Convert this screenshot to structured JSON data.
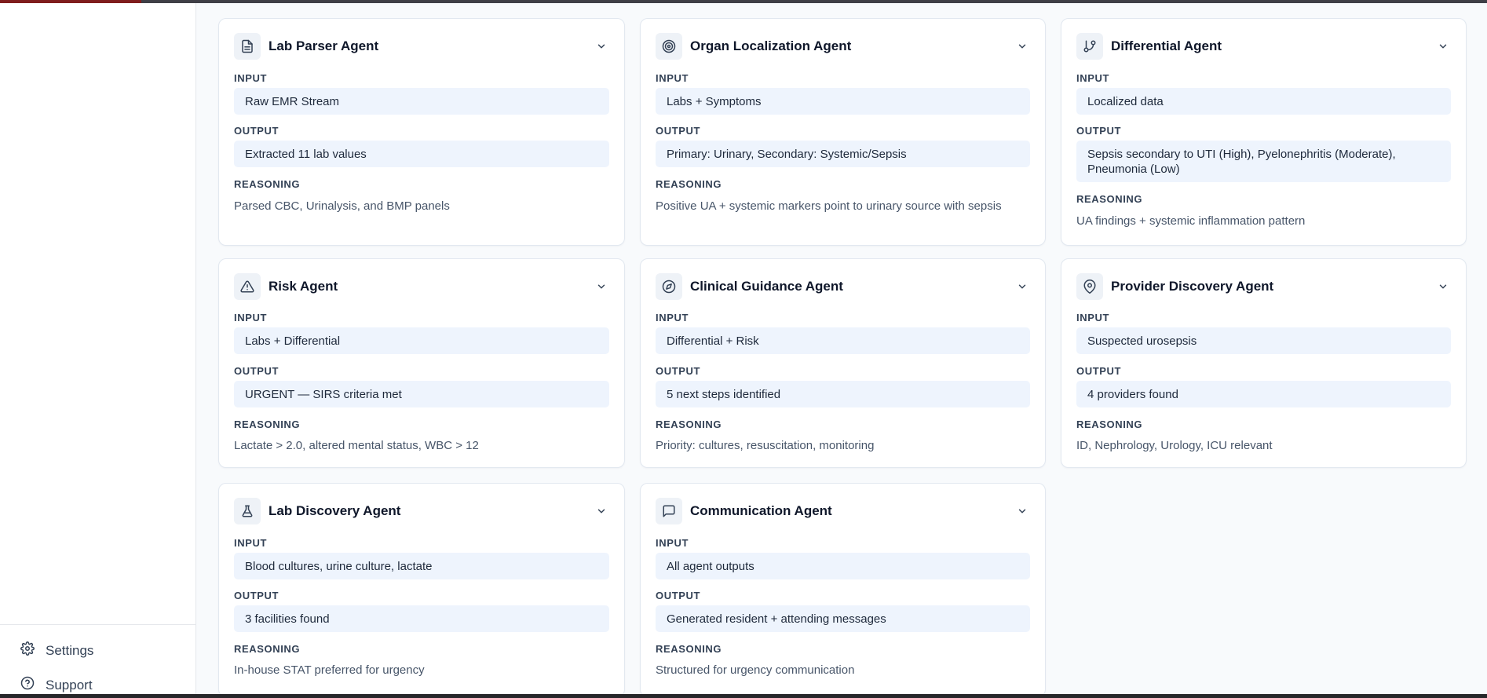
{
  "sidebar": {
    "settings_label": "Settings",
    "support_label": "Support"
  },
  "labels": {
    "input": "INPUT",
    "output": "OUTPUT",
    "reasoning": "REASONING"
  },
  "cards": [
    {
      "title": "Lab Parser Agent",
      "icon": "document-icon",
      "input": "Raw EMR Stream",
      "output": "Extracted 11 lab values",
      "reasoning": "Parsed CBC, Urinalysis, and BMP panels"
    },
    {
      "title": "Organ Localization Agent",
      "icon": "target-icon",
      "input": "Labs + Symptoms",
      "output": "Primary: Urinary, Secondary: Systemic/Sepsis",
      "reasoning": "Positive UA + systemic markers point to urinary source with sepsis"
    },
    {
      "title": "Differential Agent",
      "icon": "git-branch-icon",
      "input": "Localized data",
      "output": "Sepsis secondary to UTI (High), Pyelonephritis (Moderate), Pneumonia (Low)",
      "reasoning": "UA findings + systemic inflammation pattern"
    },
    {
      "title": "Risk Agent",
      "icon": "warning-triangle-icon",
      "input": "Labs + Differential",
      "output": "URGENT — SIRS criteria met",
      "reasoning": "Lactate > 2.0, altered mental status, WBC > 12"
    },
    {
      "title": "Clinical Guidance Agent",
      "icon": "compass-icon",
      "input": "Differential + Risk",
      "output": "5 next steps identified",
      "reasoning": "Priority: cultures, resuscitation, monitoring"
    },
    {
      "title": "Provider Discovery Agent",
      "icon": "map-pin-icon",
      "input": "Suspected urosepsis",
      "output": "4 providers found",
      "reasoning": "ID, Nephrology, Urology, ICU relevant"
    },
    {
      "title": "Lab Discovery Agent",
      "icon": "flask-icon",
      "input": "Blood cultures, urine culture, lactate",
      "output": "3 facilities found",
      "reasoning": "In-house STAT preferred for urgency"
    },
    {
      "title": "Communication Agent",
      "icon": "message-square-icon",
      "input": "All agent outputs",
      "output": "Generated resident + attending messages",
      "reasoning": "Structured for urgency communication"
    }
  ]
}
